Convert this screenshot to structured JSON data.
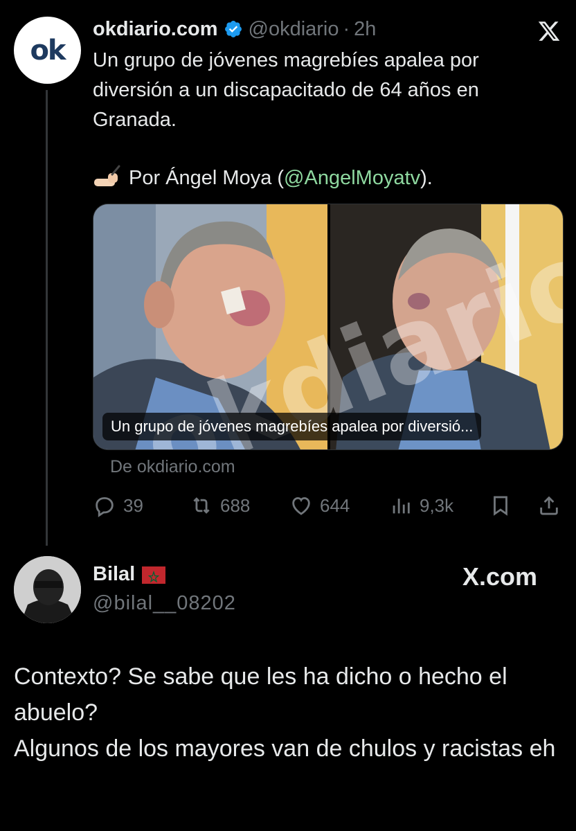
{
  "tweet": {
    "author_name": "okdiario.com",
    "handle": "@okdiario",
    "separator": "·",
    "time": "2h",
    "avatar_text": "ok",
    "text": "Un grupo de jóvenes magrebíes apalea por diversión a un discapacitado de 64 años en Granada.",
    "byline_prefix": "Por Ángel Moya (",
    "byline_mention": "@AngelMoyatv",
    "byline_suffix": ").",
    "media": {
      "caption": "Un grupo de jóvenes magrebíes apalea por diversió...",
      "watermark": "okdiario"
    },
    "source": "De okdiario.com",
    "stats": {
      "replies": "39",
      "reposts": "688",
      "likes": "644",
      "views": "9,3k"
    }
  },
  "reply": {
    "author_name": "Bilal",
    "handle": "@bilal__08202",
    "text_line1": "Contexto? Se sabe que les ha dicho o hecho el abuelo?",
    "text_line2": "Algunos de los mayores van de chulos y racistas eh"
  },
  "branding": {
    "xcom": "X.com"
  },
  "colors": {
    "background": "#000000",
    "text": "#e7e9ea",
    "muted": "#71767b",
    "mention": "#8fd9a0",
    "verified": "#1d9bf0"
  }
}
